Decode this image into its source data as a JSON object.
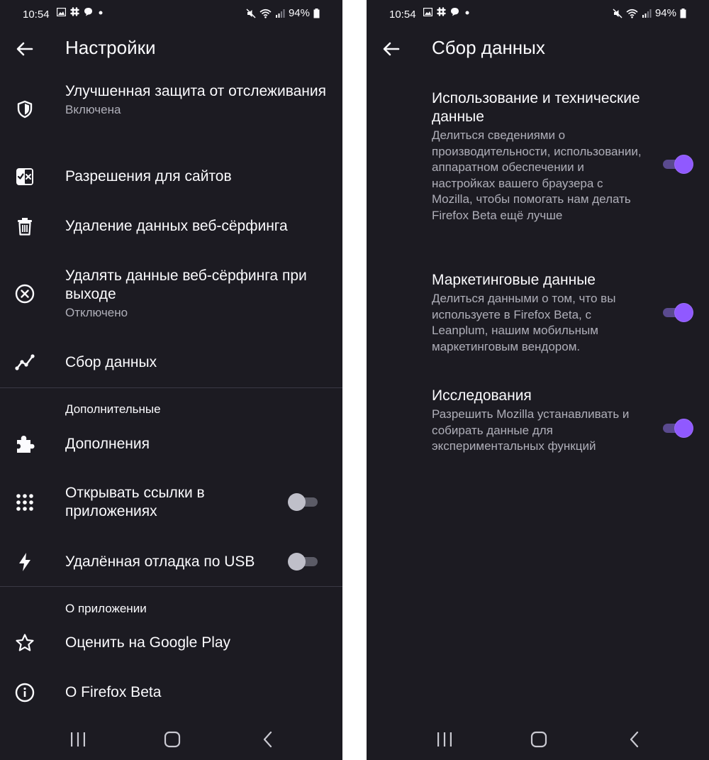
{
  "status_bar": {
    "time": "10:54",
    "battery": "94%"
  },
  "settings": {
    "title": "Настройки",
    "items": [
      {
        "title": "Улучшенная защита от отслеживания",
        "subtitle": "Включена",
        "icon": "shield-icon"
      },
      {
        "title": "Разрешения для сайтов",
        "icon": "site-permissions-icon"
      },
      {
        "title": "Удаление данных веб-сёрфинга",
        "icon": "trash-icon"
      },
      {
        "title": "Удалять данные веб-сёрфинга при выходе",
        "subtitle": "Отключено",
        "icon": "circle-x-icon"
      },
      {
        "title": "Сбор данных",
        "icon": "data-chart-icon"
      }
    ],
    "advanced_header": "Дополнительные",
    "advanced_items": [
      {
        "title": "Дополнения",
        "icon": "puzzle-icon"
      },
      {
        "title": "Открывать ссылки в приложениях",
        "icon": "apps-grid-icon",
        "switch_on": false
      },
      {
        "title": "Удалённая отладка по USB",
        "icon": "bolt-icon",
        "switch_on": false
      }
    ],
    "about_header": "О приложении",
    "about_items": [
      {
        "title": "Оценить на Google Play",
        "icon": "star-icon"
      },
      {
        "title": "О Firefox Beta",
        "icon": "info-icon"
      }
    ]
  },
  "data_collection": {
    "title": "Сбор данных",
    "prefs": [
      {
        "title": "Использование и технические данные",
        "description": "Делиться сведениями о производительности, использовании, аппаратном обеспечении и настройках вашего браузера с Mozilla, чтобы помогать нам делать Firefox Beta ещё лучше",
        "switch_on": true
      },
      {
        "title": "Маркетинговые данные",
        "description": "Делиться данными о том, что вы используете в Firefox Beta, с Leanplum, нашим мобильным маркетинговым вендором.",
        "switch_on": true
      },
      {
        "title": "Исследования",
        "description": "Разрешить Mozilla устанавливать и собирать данные для экспериментальных функций",
        "switch_on": true
      }
    ]
  },
  "colors": {
    "background": "#1c1b22",
    "text_primary": "#fbfbfe",
    "text_secondary": "#afafb9",
    "accent": "#9059ff",
    "divider": "#3a3944"
  }
}
